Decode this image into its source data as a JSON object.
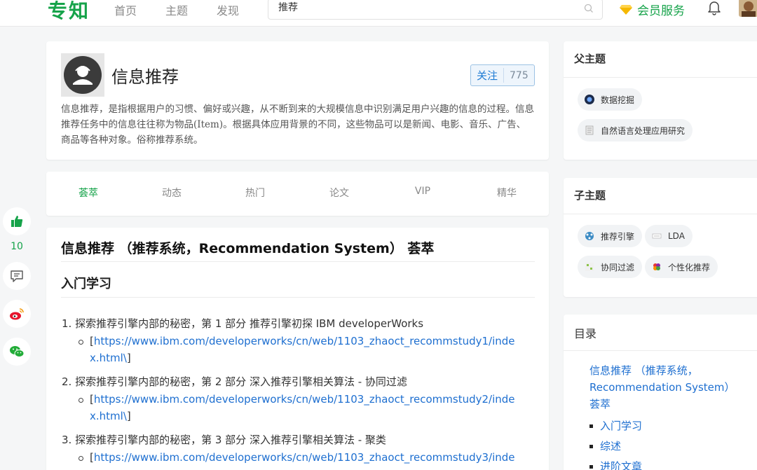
{
  "header": {
    "logo": "专知",
    "nav": [
      "首页",
      "主题",
      "发现"
    ],
    "search_value": "推荐",
    "vip_label": "会员服务"
  },
  "social": {
    "like_count": "10"
  },
  "topic": {
    "title": "信息推荐",
    "follow_label": "关注",
    "follow_count": "775",
    "description": "信息推荐，是指根据用户的习惯、偏好或兴趣，从不断到来的大规模信息中识别满足用户兴趣的信息的过程。信息推荐任务中的信息往往称为物品(Item)。根据具体应用背景的不同，这些物品可以是新闻、电影、音乐、广告、商品等各种对象。俗称推荐系统。"
  },
  "tabs": [
    "荟萃",
    "动态",
    "热门",
    "论文",
    "VIP",
    "精华"
  ],
  "content": {
    "title": "信息推荐 （推荐系统，Recommendation System） 荟萃",
    "section": "入门学习",
    "items": [
      {
        "num": "1.",
        "text": "探索推荐引擎内部的秘密，第 1 部分 推荐引擎初探 IBM developerWorks",
        "link_line1": "https://www.ibm.com/developerworks/cn/web/1103_zhaoct_recommstudy1/inde",
        "link_line2": "x.html\\"
      },
      {
        "num": "2.",
        "text": "探索推荐引擎内部的秘密，第 2 部分 深入推荐引擎相关算法 - 协同过滤",
        "link_line1": "https://www.ibm.com/developerworks/cn/web/1103_zhaoct_recommstudy2/inde",
        "link_line2": "x.html\\"
      },
      {
        "num": "3.",
        "text": "探索推荐引擎内部的秘密，第 3 部分 深入推荐引擎相关算法 - 聚类",
        "link_line1": "https://www.ibm.com/developerworks/cn/web/1103_zhaoct_recommstudy3/inde"
      }
    ]
  },
  "parent_topics": {
    "title": "父主题",
    "items": [
      "数据挖掘",
      "自然语言处理应用研究"
    ]
  },
  "child_topics": {
    "title": "子主题",
    "items": [
      "推荐引擎",
      "LDA",
      "协同过滤",
      "个性化推荐"
    ]
  },
  "toc": {
    "title": "目录",
    "main_line1": "信息推荐 （推荐系统，",
    "main_line2": "Recommendation System）",
    "main_line3": "荟萃",
    "items": [
      "入门学习",
      "综述",
      "进阶文章"
    ]
  },
  "colors": {
    "brand_green": "#16a34a",
    "link_blue": "#1e6fd0"
  }
}
